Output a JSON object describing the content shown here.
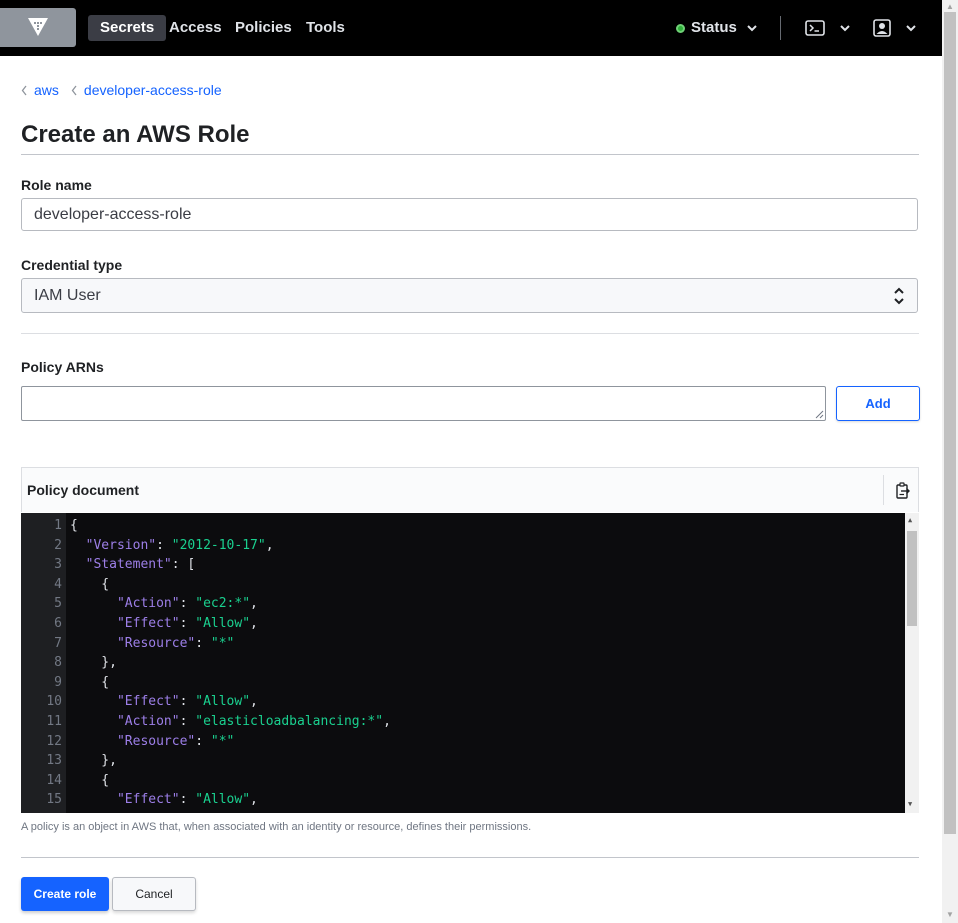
{
  "nav": {
    "items": [
      "Secrets",
      "Access",
      "Policies",
      "Tools"
    ],
    "active": "Secrets",
    "status_label": "Status",
    "status_color": "#2eb039"
  },
  "breadcrumbs": [
    {
      "label": "aws"
    },
    {
      "label": "developer-access-role"
    }
  ],
  "page": {
    "title": "Create an AWS Role"
  },
  "form": {
    "role_name_label": "Role name",
    "role_name_value": "developer-access-role",
    "credential_type_label": "Credential type",
    "credential_type_value": "IAM User",
    "policy_arns_label": "Policy ARNs",
    "policy_arns_value": "",
    "add_label": "Add",
    "policy_document_label": "Policy document",
    "help_text": "A policy is an object in AWS that, when associated with an identity or resource, defines their permissions.",
    "create_label": "Create role",
    "cancel_label": "Cancel"
  },
  "code_lines": [
    "{",
    "  \"Version\": \"2012-10-17\",",
    "  \"Statement\": [",
    "    {",
    "      \"Action\": \"ec2:*\",",
    "      \"Effect\": \"Allow\",",
    "      \"Resource\": \"*\"",
    "    },",
    "    {",
    "      \"Effect\": \"Allow\",",
    "      \"Action\": \"elasticloadbalancing:*\",",
    "      \"Resource\": \"*\"",
    "    },",
    "    {",
    "      \"Effect\": \"Allow\","
  ],
  "icons": [
    "vault-logo-icon",
    "terminal-icon",
    "user-icon",
    "copy-icon",
    "chevron-down-icon",
    "chevron-left-icon",
    "select-arrows-icon"
  ],
  "colors": {
    "accent": "#1563ff",
    "nav_bg": "#000000",
    "editor_bg": "#0c0c0e",
    "code_key": "#9d7fe8",
    "code_string": "#1ad08f"
  }
}
